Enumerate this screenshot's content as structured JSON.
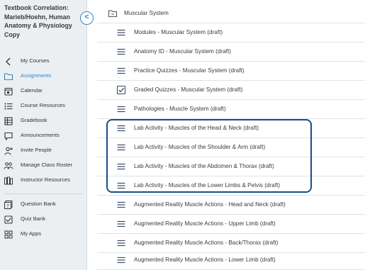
{
  "sidebar": {
    "course_title": "Textbook Correlation: Marieb/Hoehn, Human Anatomy & Physiology Copy",
    "collapse_symbol": "<",
    "nav_items": [
      {
        "label": "My Courses",
        "icon": "chevron-left-icon"
      },
      {
        "label": "Assignments",
        "icon": "folder-icon",
        "active": true
      },
      {
        "label": "Calendar",
        "icon": "calendar-icon"
      },
      {
        "label": "Course Resources",
        "icon": "list-icon"
      },
      {
        "label": "Gradebook",
        "icon": "gradebook-icon"
      },
      {
        "label": "Announcements",
        "icon": "speech-bubble-icon"
      },
      {
        "label": "Invite People",
        "icon": "person-add-icon"
      },
      {
        "label": "Manage Class Roster",
        "icon": "roster-icon"
      },
      {
        "label": "Instructor Resources",
        "icon": "books-icon"
      },
      {
        "label": "Question Bank",
        "icon": "question-bank-icon"
      },
      {
        "label": "Quiz Bank",
        "icon": "checkbox-icon"
      },
      {
        "label": "My Apps",
        "icon": "apps-icon"
      }
    ]
  },
  "main": {
    "folder": {
      "label": "Muscular System",
      "icon": "folder-icon"
    },
    "rows": [
      {
        "label": "Modules - Muscular System (draft)",
        "icon": "lines-icon"
      },
      {
        "label": "Anatomy ID - Muscular System (draft)",
        "icon": "lines-icon"
      },
      {
        "label": "Practice Quizzes - Muscular System (draft)",
        "icon": "lines-icon"
      },
      {
        "label": "Graded Quizzes - Muscular System (draft)",
        "icon": "checkbox-icon"
      },
      {
        "label": "Pathologies - Muscle System (draft)",
        "icon": "lines-icon"
      },
      {
        "label": "Lab Activity - Muscles of the Head & Neck (draft)",
        "icon": "lines-icon"
      },
      {
        "label": "Lab Activity - Muscles of the Shoulder & Arm (draft)",
        "icon": "lines-icon"
      },
      {
        "label": "Lab Activity - Muscles of the Abdomen & Thorax (draft)",
        "icon": "lines-icon"
      },
      {
        "label": "Lab Activity - Muscles of the Lower Limbs & Pelvis (draft)",
        "icon": "lines-icon"
      },
      {
        "label": "Augmented Reality Muscle Actions - Head and Neck (draft)",
        "icon": "lines-icon"
      },
      {
        "label": "Augmented Reality Muscle Actions - Upper Limb (draft)",
        "icon": "lines-icon"
      },
      {
        "label": "Augmented Reality Muscle Actions - Back/Thorax (draft)",
        "icon": "lines-icon"
      },
      {
        "label": "Augmented Reality Muscle Actions - Lower Limb (draft)",
        "icon": "lines-icon"
      }
    ]
  },
  "colors": {
    "accent": "#2f86c7",
    "highlight_border": "#164e8a",
    "sidebar_bg": "#eceff1"
  }
}
